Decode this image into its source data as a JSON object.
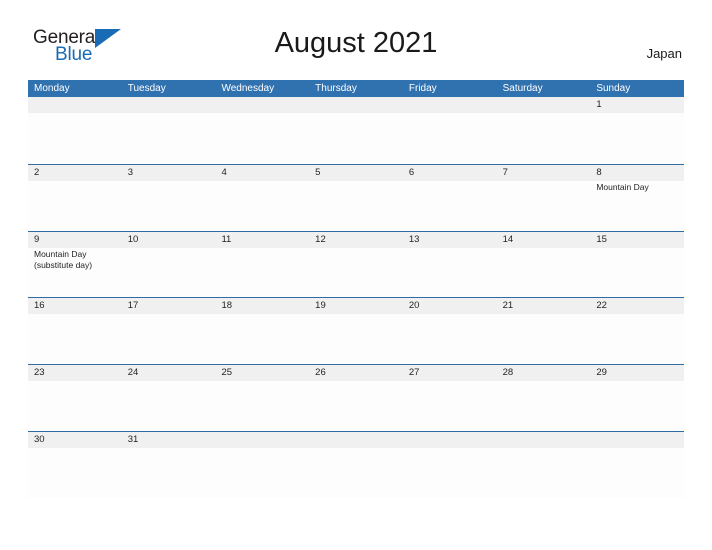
{
  "logo": {
    "word_one": "General",
    "word_two": "Blue",
    "flag_icon": "triangle-flag-icon",
    "brand_color": "#1a6bb5"
  },
  "header": {
    "title": "August 2021",
    "country": "Japan"
  },
  "calendar": {
    "header_color": "#3071b0",
    "row_border_color": "#2e6da4",
    "date_band_color": "#f0f0f0",
    "day_names": [
      "Monday",
      "Tuesday",
      "Wednesday",
      "Thursday",
      "Friday",
      "Saturday",
      "Sunday"
    ],
    "weeks": [
      [
        {
          "date": ""
        },
        {
          "date": ""
        },
        {
          "date": ""
        },
        {
          "date": ""
        },
        {
          "date": ""
        },
        {
          "date": ""
        },
        {
          "date": "1"
        }
      ],
      [
        {
          "date": "2"
        },
        {
          "date": "3"
        },
        {
          "date": "4"
        },
        {
          "date": "5"
        },
        {
          "date": "6"
        },
        {
          "date": "7"
        },
        {
          "date": "8",
          "event_line_1": "Mountain Day"
        }
      ],
      [
        {
          "date": "9",
          "event_line_1": "Mountain Day",
          "event_line_2": "(substitute day)"
        },
        {
          "date": "10"
        },
        {
          "date": "11"
        },
        {
          "date": "12"
        },
        {
          "date": "13"
        },
        {
          "date": "14"
        },
        {
          "date": "15"
        }
      ],
      [
        {
          "date": "16"
        },
        {
          "date": "17"
        },
        {
          "date": "18"
        },
        {
          "date": "19"
        },
        {
          "date": "20"
        },
        {
          "date": "21"
        },
        {
          "date": "22"
        }
      ],
      [
        {
          "date": "23"
        },
        {
          "date": "24"
        },
        {
          "date": "25"
        },
        {
          "date": "26"
        },
        {
          "date": "27"
        },
        {
          "date": "28"
        },
        {
          "date": "29"
        }
      ],
      [
        {
          "date": "30"
        },
        {
          "date": "31"
        },
        {
          "date": ""
        },
        {
          "date": ""
        },
        {
          "date": ""
        },
        {
          "date": ""
        },
        {
          "date": ""
        }
      ]
    ]
  }
}
